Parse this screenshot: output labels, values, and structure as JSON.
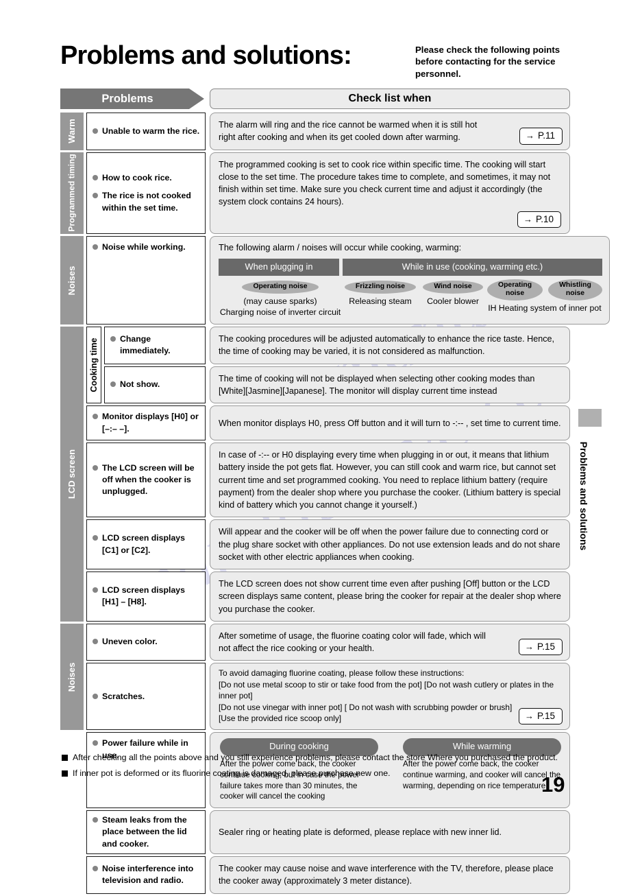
{
  "header": {
    "title": "Problems and solutions:",
    "subtitle": "Please check the following points before contacting for the service personnel.",
    "col_problems": "Problems",
    "col_check": "Check list when"
  },
  "bands": [
    {
      "category": "Warm",
      "rows": [
        {
          "problems": [
            "Unable to warm the rice."
          ],
          "answer": "The alarm will ring and the rice cannot be warmed when it is still hot right after cooking and when its get cooled down after warming.",
          "page_ref": "P.11"
        }
      ]
    },
    {
      "category": "Programmed timing",
      "rows": [
        {
          "problems": [
            "How to cook rice.",
            "The rice is not cooked within the set time."
          ],
          "answer": "The programmed cooking is set to cook rice within specific time. The cooking will start close to the set time. The procedure takes time to complete, and sometimes, it may not finish within set time. Make sure you check current time and adjust it accordingly (the system clock contains 24 hours).",
          "page_ref": "P.10"
        }
      ]
    },
    {
      "category": "Noises",
      "rows": [
        {
          "problems": [
            "Noise while working."
          ],
          "noise_panel": {
            "intro": "The following alarm / noises will occur while cooking, warming:",
            "head_left": "When plugging in",
            "head_right": "While in use (cooking, warming etc.)",
            "items": [
              {
                "bubbles": [
                  "Operating noise"
                ],
                "caption": "(may cause sparks)\nCharging noise of inverter circuit"
              },
              {
                "bubbles": [
                  "Frizzling noise"
                ],
                "caption": "Releasing steam"
              },
              {
                "bubbles": [
                  "Wind noise"
                ],
                "caption": "Cooler blower"
              },
              {
                "bubbles": [
                  "Operating noise",
                  "Whistling noise"
                ],
                "caption": "IH Heating system of inner pot"
              }
            ]
          }
        }
      ]
    },
    {
      "category": "LCD screen",
      "subcategory": "Cooking time",
      "rows": [
        {
          "sub": true,
          "problems": [
            "Change immediately."
          ],
          "answer": "The cooking procedures will be adjusted automatically to enhance the rice taste. Hence, the time of cooking may be varied, it is not considered as malfunction."
        },
        {
          "sub": true,
          "problems": [
            "Not show."
          ],
          "answer": "The time of cooking will not be displayed when selecting other cooking modes than [White][Jasmine][Japanese]. The monitor will display current time instead"
        },
        {
          "problems": [
            "Monitor displays [H0] or [–:– –]."
          ],
          "answer": "When monitor displays H0, press Off button and it will turn to -:-- , set time to current time."
        },
        {
          "problems": [
            "The LCD screen will be off when the cooker is unplugged."
          ],
          "answer": "In case of -:-- or H0 displaying every time when plugging in or out, it means that lithium battery inside the pot gets flat. However, you can still cook and warm rice, but cannot set current time and set programmed cooking. You need to replace lithium battery (require payment) from the dealer shop where you purchase the cooker. (Lithium battery is special kind of battery which you cannot change it yourself.)"
        },
        {
          "problems": [
            "LCD screen displays [C1] or [C2]."
          ],
          "answer": "Will appear and the cooker will be off when the power failure due to connecting cord or the plug share socket with other appliances. Do not use extension leads and do not share socket with other electric appliances when cooking."
        },
        {
          "problems": [
            "LCD screen displays [H1] – [H8]."
          ],
          "answer": "The LCD screen does not show current time even after pushing [Off] button or the LCD screen displays same content, please bring the cooker for repair at the dealer shop where you purchase the cooker."
        }
      ]
    },
    {
      "category": "Noises",
      "rows": [
        {
          "problems": [
            "Uneven color."
          ],
          "answer": "After sometime of usage, the fluorine coating color will fade, which will not affect the rice cooking or your health.",
          "page_ref": "P.15"
        },
        {
          "problems": [
            "Scratches."
          ],
          "answer": "To avoid damaging fluorine coating, please follow these instructions:\n[Do not use metal scoop to stir or take food from the pot] [Do not wash cutlery or plates in the inner pot]\n[Do not use vinegar with inner pot] [ Do not wash with scrubbing powder or brush]\n[Use the provided rice scoop only]",
          "page_ref": "P.15"
        }
      ]
    },
    {
      "category": "",
      "rows": [
        {
          "problems": [
            "Power failure while in use."
          ],
          "power_panel": {
            "left_head": "During cooking",
            "left_text": "After the power come back, the cooker continue cooking, but in case the power failure takes more than 30 minutes, the cooker will cancel the cooking",
            "right_head": "While warming",
            "right_text": "After the power come back, the cooker continue warming, and cooker will cancel the warming, depending on rice temperature"
          }
        },
        {
          "problems": [
            "Steam leaks from the place between the lid and cooker."
          ],
          "answer": "Sealer ring or heating plate is deformed, please replace with new inner lid."
        },
        {
          "problems": [
            "Noise interference into television and radio."
          ],
          "answer": "The cooker may cause noise and wave interference with the TV, therefore, please place the cooker away (approximately 3 meter distance)."
        }
      ]
    }
  ],
  "notes": [
    "After checking all the points above and you still experience problems, please contact the store Where you purchased the product.",
    "If inner pot is deformed or its fluorine coating is damaged, please purchase new one."
  ],
  "side_tab_text": "Problems and solutions",
  "page_number": "19",
  "arrow_glyph": "→",
  "watermark": [
    "manualshive.com",
    "manualshive"
  ],
  "colors": {
    "category_grey": "#989898",
    "header_grey": "#767676",
    "answer_bg": "#ececec",
    "bubble_grey": "#aeaeae",
    "subhead_grey": "#696969"
  }
}
